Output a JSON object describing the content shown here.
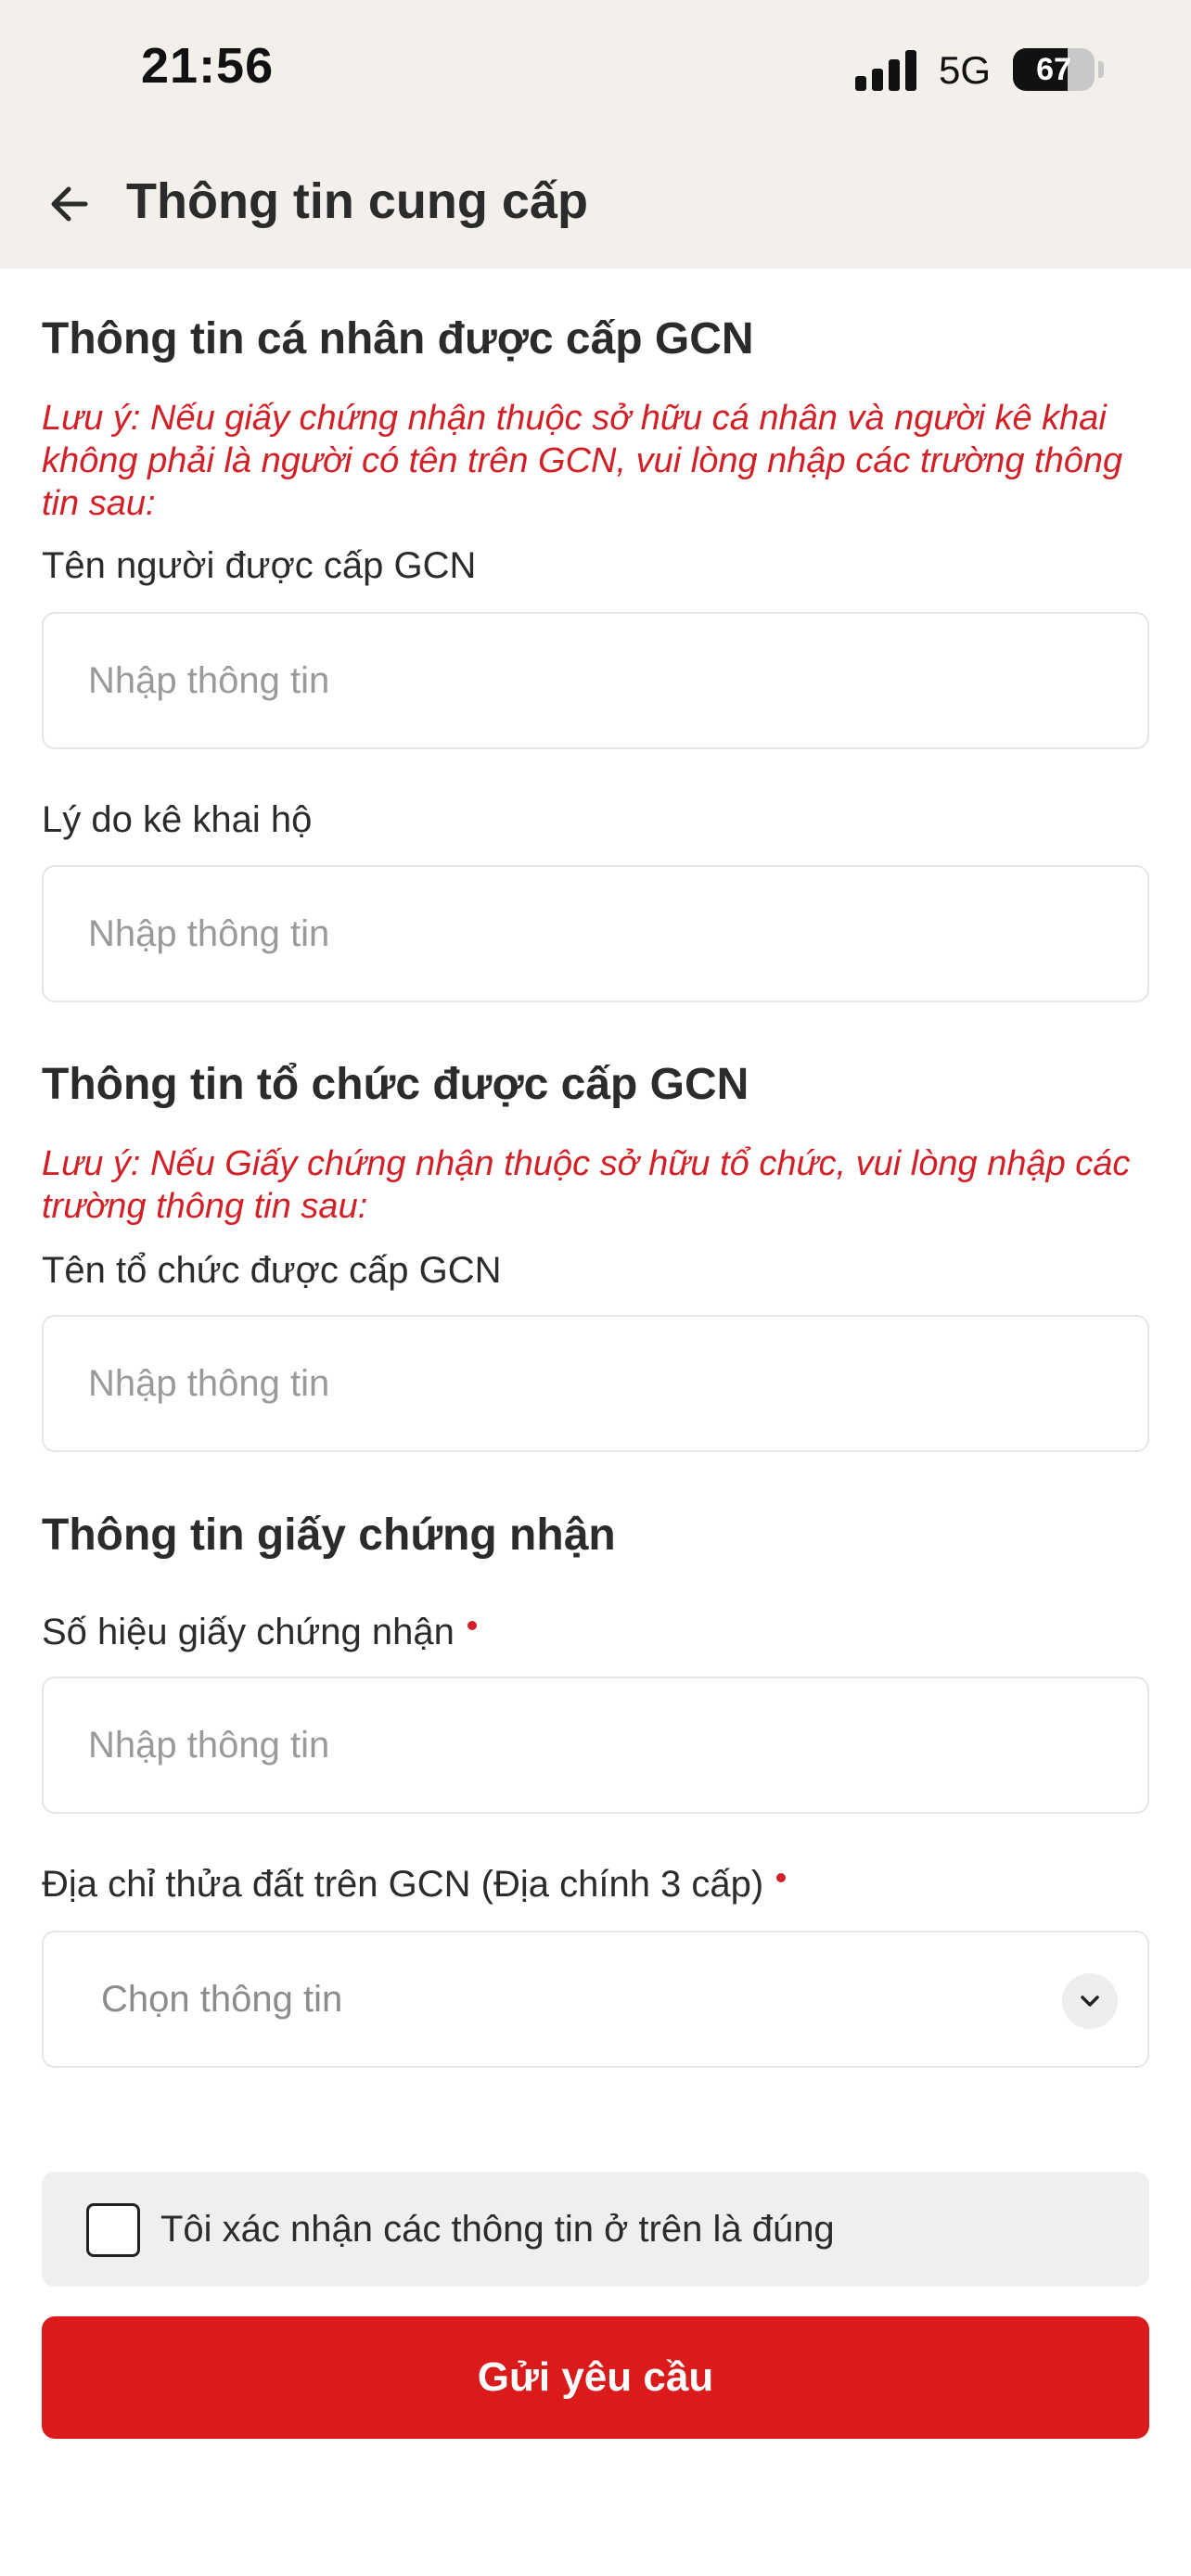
{
  "status_bar": {
    "time": "21:56",
    "network": "5G",
    "battery": "67",
    "battery_level": 0.67,
    "signal_bars": 4
  },
  "header": {
    "title": "Thông tin cung cấp"
  },
  "personal_section": {
    "title": "Thông tin cá nhân được cấp GCN",
    "note": "Lưu ý: Nếu giấy chứng nhận thuộc sở hữu cá nhân và người kê khai không phải là người có tên trên GCN, vui lòng nhập các trường thông tin sau:",
    "fields": [
      {
        "label": "Tên người được cấp GCN",
        "placeholder": "Nhập thông tin",
        "value": ""
      },
      {
        "label": "Lý do kê khai hộ",
        "placeholder": "Nhập thông tin",
        "value": ""
      }
    ]
  },
  "organization_section": {
    "title": "Thông tin tổ chức được cấp GCN",
    "note": "Lưu ý: Nếu Giấy chứng nhận thuộc sở hữu tổ chức, vui lòng nhập các trường thông tin sau:",
    "fields": [
      {
        "label": "Tên tổ chức được cấp GCN",
        "placeholder": "Nhập thông tin",
        "value": ""
      }
    ]
  },
  "certificate_section": {
    "title": "Thông tin giấy chứng nhận",
    "fields": [
      {
        "label": "Số hiệu giấy chứng nhận",
        "placeholder": "Nhập thông tin",
        "value": "",
        "required": true
      },
      {
        "label": "Địa chỉ thửa đất trên GCN (Địa chính 3 cấp)",
        "select_value": "Chọn thông tin",
        "required": true
      }
    ]
  },
  "confirm": {
    "label": "Tôi xác nhận các thông tin ở trên là đúng",
    "checked": false
  },
  "submit": {
    "label": "Gửi yêu cầu"
  },
  "colors": {
    "accent": "#db1b1b",
    "note_text": "#d31f26",
    "header_bg": "#f3f0eb"
  },
  "icons": {
    "back": "arrow-left-icon",
    "chevron": "chevron-down-icon",
    "signal": "cellular-signal-icon",
    "battery": "battery-icon"
  }
}
